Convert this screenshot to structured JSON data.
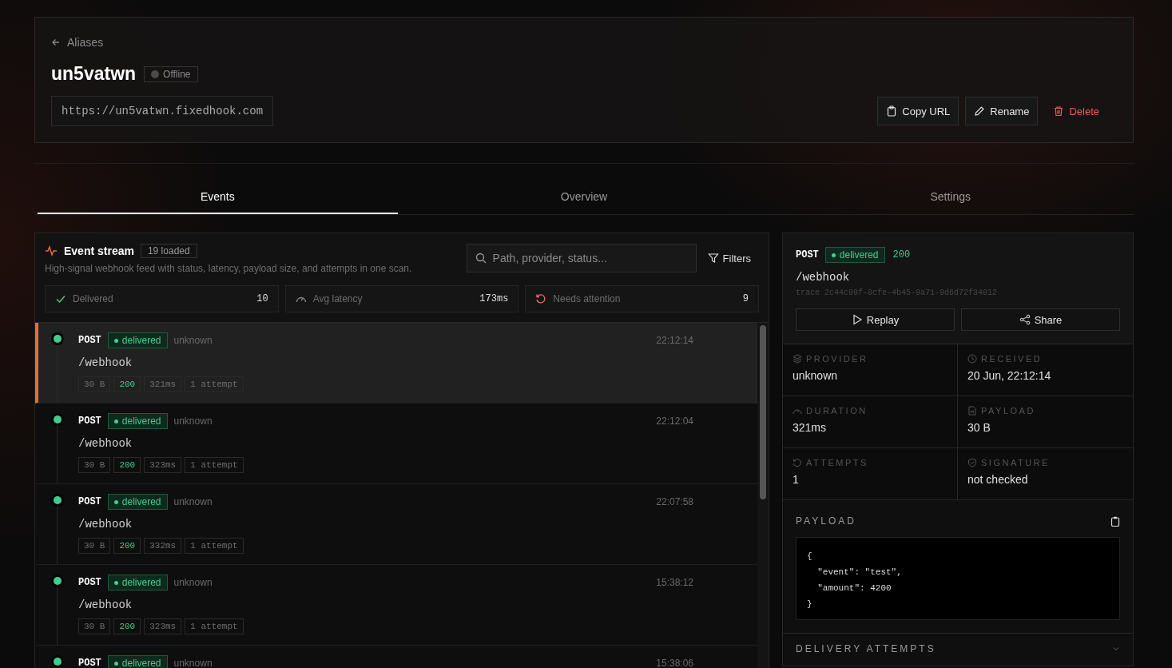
{
  "header": {
    "back_label": "Aliases",
    "name": "un5vatwn",
    "status": {
      "label": "Offline",
      "online": false
    },
    "url": "https://un5vatwn.fixedhook.com",
    "actions": [
      {
        "label": "Copy URL",
        "kind": "copy"
      },
      {
        "label": "Rename",
        "kind": "rename"
      },
      {
        "label": "Delete",
        "kind": "delete"
      }
    ]
  },
  "tabs": [
    {
      "label": "Events",
      "selected": true
    },
    {
      "label": "Overview",
      "selected": false
    },
    {
      "label": "Settings",
      "selected": false
    }
  ],
  "stream": {
    "title": "Event stream",
    "count": "19 loaded",
    "subtitle": "High-signal webhook feed with status, latency, payload size, and attempts in one scan.",
    "search": {
      "placeholder": "Path, provider, status..."
    },
    "filters_label": "Filters",
    "stats": [
      {
        "kind": "delivered",
        "label": "Delivered",
        "value": "10"
      },
      {
        "kind": "latency",
        "label": "Avg latency",
        "value": "173ms"
      },
      {
        "kind": "attention",
        "label": "Needs attention",
        "value": "9"
      }
    ],
    "events": [
      {
        "method": "POST",
        "status": "delivered",
        "provider": "unknown",
        "time": "22:12:14",
        "path": "/webhook",
        "tags": [
          "30 B",
          "200",
          "321ms",
          "1 attempt"
        ],
        "selected": true
      },
      {
        "method": "POST",
        "status": "delivered",
        "provider": "unknown",
        "time": "22:12:04",
        "path": "/webhook",
        "tags": [
          "30 B",
          "200",
          "323ms",
          "1 attempt"
        ],
        "selected": false
      },
      {
        "method": "POST",
        "status": "delivered",
        "provider": "unknown",
        "time": "22:07:58",
        "path": "/webhook",
        "tags": [
          "30 B",
          "200",
          "332ms",
          "1 attempt"
        ],
        "selected": false
      },
      {
        "method": "POST",
        "status": "delivered",
        "provider": "unknown",
        "time": "15:38:12",
        "path": "/webhook",
        "tags": [
          "30 B",
          "200",
          "323ms",
          "1 attempt"
        ],
        "selected": false
      },
      {
        "method": "POST",
        "status": "delivered",
        "provider": "unknown",
        "time": "15:38:06",
        "selected": false
      }
    ]
  },
  "detail": {
    "method": "POST",
    "status": "delivered",
    "code": "200",
    "path": "/webhook",
    "trace": "trace 2c44c99f-0cfe-4b45-9a71-9d6d72f34012",
    "buttons": [
      {
        "label": "Replay",
        "kind": "replay"
      },
      {
        "label": "Share",
        "kind": "share"
      }
    ],
    "fields": [
      {
        "kind": "provider",
        "label": "PROVIDER",
        "value": "unknown"
      },
      {
        "kind": "received",
        "label": "RECEIVED",
        "value": "20 Jun, 22:12:14"
      },
      {
        "kind": "duration",
        "label": "DURATION",
        "value": "321ms"
      },
      {
        "kind": "payload",
        "label": "PAYLOAD",
        "value": "30 B"
      },
      {
        "kind": "attempts",
        "label": "ATTEMPTS",
        "value": "1"
      },
      {
        "kind": "signature",
        "label": "SIGNATURE",
        "value": "not checked"
      }
    ],
    "payload": {
      "title": "PAYLOAD",
      "lines": [
        "{",
        "  \"event\": \"test\",",
        "  \"amount\": 4200",
        "}"
      ]
    },
    "attempts_title": "DELIVERY ATTEMPTS",
    "attempts_expanded": false
  }
}
